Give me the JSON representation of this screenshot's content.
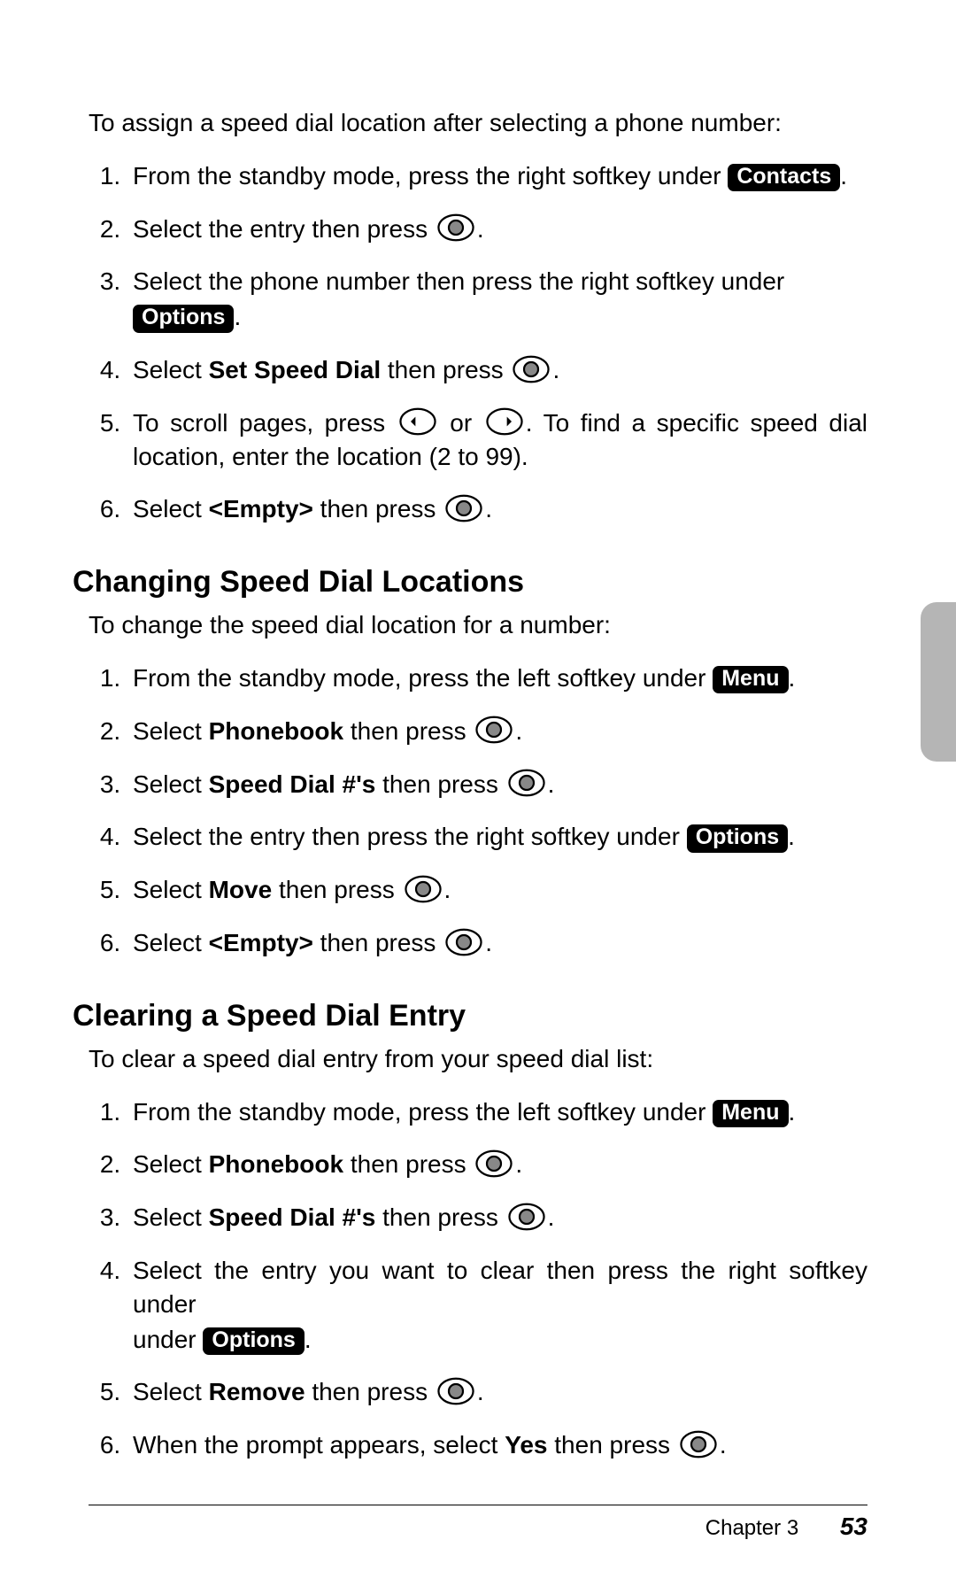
{
  "softkeys": {
    "contacts": "Contacts",
    "options": "Options",
    "menu": "Menu"
  },
  "boldTerms": {
    "setSpeedDial": "Set Speed Dial",
    "empty": "<Empty>",
    "phonebook": "Phonebook",
    "speedDialNums": "Speed Dial #'s",
    "move": "Move",
    "remove": "Remove",
    "yes": "Yes"
  },
  "sectionA": {
    "intro": "To assign a speed dial location after selecting a phone number:",
    "s1a": "From the standby mode, press the right softkey under ",
    "s2a": "Select the entry then press ",
    "s3a": "Select the phone number then press the right softkey under ",
    "s4a": "Select ",
    "s4b": " then press ",
    "s5a": "To scroll pages, press ",
    "s5b": " or ",
    "s5c": ". To find a specific speed dial location, enter the location (2 to 99).",
    "s6a": "Select ",
    "s6b": " then press "
  },
  "sectionB": {
    "heading": "Changing Speed Dial Locations",
    "intro": "To change the speed dial location for a number:",
    "s1a": "From the standby mode, press the left softkey under ",
    "s2a": "Select ",
    "s2b": " then press ",
    "s3a": "Select ",
    "s3b": " then press ",
    "s4a": "Select the entry then press the right softkey under ",
    "s5a": "Select ",
    "s5b": " then press ",
    "s6a": "Select ",
    "s6b": " then press "
  },
  "sectionC": {
    "heading": "Clearing a Speed Dial Entry",
    "intro": "To clear a speed dial entry from your speed dial list:",
    "s1a": "From the standby mode, press the left softkey under ",
    "s2a": "Select ",
    "s2b": " then press ",
    "s3a": "Select ",
    "s3b": " then press ",
    "s4a": "Select the entry you want to clear then press the right softkey under ",
    "s5a": "Select ",
    "s5b": " then press ",
    "s6a": "When the prompt appears, select ",
    "s6b": " then press "
  },
  "footer": {
    "chapter": "Chapter 3",
    "page": "53"
  }
}
